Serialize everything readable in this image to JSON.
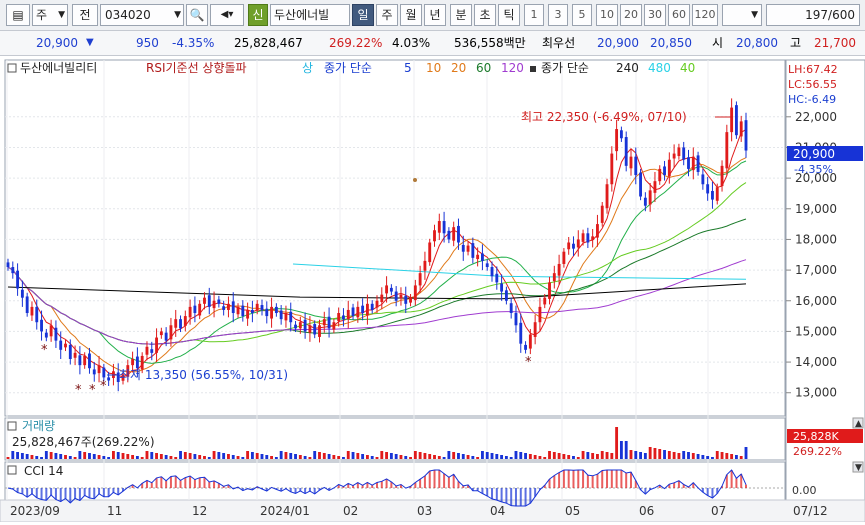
{
  "toolbar": {
    "code_type": "주",
    "jeon": "전",
    "stock_code": "034020",
    "credit": "신",
    "stock_name": "두산에너빌",
    "periods": [
      "일",
      "주",
      "월",
      "년",
      "분",
      "초",
      "틱"
    ],
    "active_period": "일",
    "intervals": [
      "1",
      "3",
      "5",
      "10",
      "20",
      "30",
      "60",
      "120"
    ],
    "page_counter": "197",
    "page_total": "/600"
  },
  "info": {
    "price": "20,900",
    "change": "950",
    "change_pct": "-4.35%",
    "volume": "25,828,467",
    "vol_ratio": "269.22%",
    "turnover": "4.03%",
    "amount": "536,558백만",
    "best_ask_label": "최우선",
    "ask": "20,900",
    "bid": "20,850",
    "open_label": "시",
    "open": "20,800",
    "high_label": "고",
    "high": "21,700"
  },
  "legend": {
    "name": "두산에너빌리티",
    "rsi": "RSI기준선 상향돌파",
    "signal": "상",
    "ma_short_label": "종가 단순",
    "ma_short": [
      "5",
      "10",
      "20",
      "60",
      "120"
    ],
    "ma_long_label": "종가 단순",
    "ma_long": [
      "240",
      "480",
      "40"
    ],
    "stats": [
      "LH:67.42",
      "LC:56.55",
      "HC:-6.49"
    ]
  },
  "annotations": {
    "high": "최고 22,350 (-6.49%, 07/10)",
    "low": "최저 13,350 (56.55%, 10/31)"
  },
  "price_tag": {
    "value": "20,900",
    "pct": "-4.35%"
  },
  "volume_panel": {
    "title": "거래량",
    "value": "25,828,467주(269.22%)",
    "tag_value": "25,828K",
    "tag_pct": "269.22%"
  },
  "cci_panel": {
    "title": "CCI 14",
    "tick": "0.00"
  },
  "colors": {
    "up": "#e01b1b",
    "down": "#1733d6",
    "ma5": "#e01b1b",
    "ma10": "#e07a1b",
    "ma20": "#22b04a",
    "ma60": "#1b7a2a",
    "ma120": "#a03cd0",
    "ma240": "#000000",
    "ma480": "#2ad1e6",
    "ma40": "#66cc22",
    "tag_bg": "#1733d6",
    "vol_tag_bg": "#e01b1b"
  },
  "chart_data": {
    "type": "candlestick",
    "y_ticks": [
      "22,000",
      "21,000",
      "20,000",
      "19,000",
      "18,000",
      "17,000",
      "16,000",
      "15,000",
      "14,000",
      "13,000"
    ],
    "ylim": [
      12600,
      23200
    ],
    "x_ticks": [
      "2023/09",
      "11",
      "12",
      "2024/01",
      "02",
      "03",
      "04",
      "05",
      "06",
      "07",
      "07/12"
    ],
    "closes": [
      17100,
      16900,
      16400,
      16100,
      15600,
      15800,
      15300,
      15000,
      14800,
      15200,
      14700,
      14400,
      14600,
      14100,
      14300,
      13900,
      14200,
      13800,
      13600,
      13900,
      13500,
      13400,
      13700,
      13350,
      13600,
      13900,
      14100,
      13800,
      14200,
      14500,
      14300,
      14800,
      15000,
      14700,
      15200,
      15400,
      15100,
      15500,
      15800,
      15600,
      15900,
      16100,
      15800,
      16000,
      15900,
      15700,
      15900,
      15600,
      15800,
      15500,
      15700,
      15600,
      15900,
      15700,
      15500,
      15800,
      15600,
      15400,
      15600,
      15300,
      15100,
      15300,
      15000,
      15200,
      14900,
      15200,
      15400,
      15100,
      15300,
      15600,
      15400,
      15700,
      15500,
      15800,
      15600,
      15900,
      15700,
      16000,
      16200,
      16500,
      16300,
      16000,
      16200,
      15900,
      16100,
      16500,
      16900,
      17300,
      17900,
      18300,
      18600,
      18200,
      18000,
      18400,
      17900,
      17600,
      17800,
      17400,
      17500,
      17300,
      17100,
      16800,
      16600,
      16300,
      16000,
      15600,
      15200,
      14600,
      14400,
      14900,
      15300,
      15800,
      16100,
      16600,
      16900,
      17200,
      17600,
      17900,
      17700,
      18000,
      18200,
      17900,
      18100,
      18500,
      19100,
      19800,
      20800,
      21600,
      21300,
      20400,
      20700,
      20100,
      19400,
      19100,
      19600,
      19900,
      20300,
      20100,
      20600,
      20800,
      21000,
      20600,
      20300,
      20700,
      20200,
      19800,
      19500,
      19300,
      19700,
      20400,
      21500,
      22300,
      21400,
      21850,
      20900
    ],
    "volume_note": "daily volume bars, spike near 06 and last day",
    "cci_range": [
      -200,
      200
    ]
  }
}
